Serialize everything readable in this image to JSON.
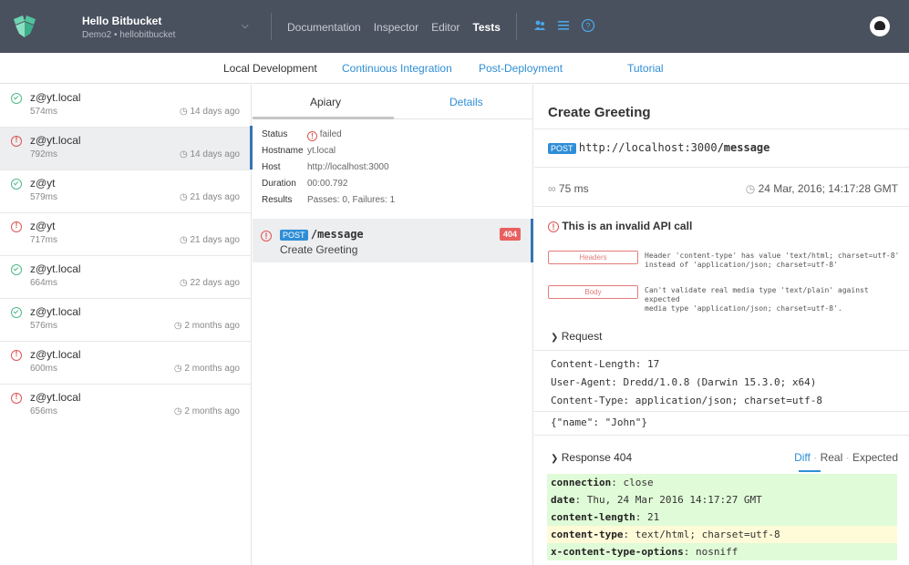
{
  "topbar": {
    "project_name": "Hello Bitbucket",
    "project_sub": "Demo2 • hellobitbucket",
    "nav": [
      "Documentation",
      "Inspector",
      "Editor",
      "Tests"
    ],
    "active_nav": "Tests"
  },
  "subnav": [
    "Local Development",
    "Continuous Integration",
    "Post-Deployment",
    "Tutorial"
  ],
  "runs": [
    {
      "status": "ok",
      "host": "z@yt.local",
      "ms": "574ms",
      "ago": "14 days ago"
    },
    {
      "status": "fail",
      "host": "z@yt.local",
      "ms": "792ms",
      "ago": "14 days ago"
    },
    {
      "status": "ok",
      "host": "z@yt",
      "ms": "579ms",
      "ago": "21 days ago"
    },
    {
      "status": "fail",
      "host": "z@yt",
      "ms": "717ms",
      "ago": "21 days ago"
    },
    {
      "status": "ok",
      "host": "z@yt.local",
      "ms": "664ms",
      "ago": "22 days ago"
    },
    {
      "status": "ok",
      "host": "z@yt.local",
      "ms": "576ms",
      "ago": "2 months ago"
    },
    {
      "status": "fail",
      "host": "z@yt.local",
      "ms": "600ms",
      "ago": "2 months ago"
    },
    {
      "status": "fail",
      "host": "z@yt.local",
      "ms": "656ms",
      "ago": "2 months ago"
    }
  ],
  "middle": {
    "tab_apiary": "Apiary",
    "tab_details": "Details",
    "props": {
      "status_label": "Status",
      "status_value": "failed",
      "hostname_label": "Hostname",
      "hostname_value": "yt.local",
      "host_label": "Host",
      "host_value": "http://localhost:3000",
      "duration_label": "Duration",
      "duration_value": "00:00.792",
      "results_label": "Results",
      "results_value": "Passes: 0, Failures: 1"
    },
    "endpoint": {
      "method": "POST",
      "path": "/message",
      "name": "Create Greeting",
      "code": "404"
    }
  },
  "right": {
    "title": "Create Greeting",
    "method": "POST",
    "url_base": "http://localhost:3000",
    "url_path": "/message",
    "duration": "75 ms",
    "timestamp": "24 Mar, 2016; 14:17:28 GMT",
    "invalid": "This is an invalid API call",
    "errors": [
      {
        "label": "Headers",
        "line1": "Header 'content-type' has value 'text/html; charset=utf-8'",
        "line2": "instead of 'application/json; charset=utf-8'"
      },
      {
        "label": "Body",
        "line1": "Can't validate real media type 'text/plain' against expected",
        "line2": "media type 'application/json; charset=utf-8'."
      }
    ],
    "request_label": "Request",
    "request_headers": [
      "Content-Length: 17",
      "User-Agent: Dredd/1.0.8 (Darwin 15.3.0; x64)",
      "Content-Type: application/json; charset=utf-8"
    ],
    "request_body": "{\"name\": \"John\"}",
    "response_label": "Response 404",
    "diff_tabs": {
      "diff": "Diff",
      "real": "Real",
      "expected": "Expected"
    },
    "response_headers": [
      {
        "key": "connection",
        "value": "close"
      },
      {
        "key": "date",
        "value": "Thu, 24 Mar 2016 14:17:27 GMT"
      },
      {
        "key": "content-length",
        "value": "21"
      },
      {
        "key": "content-type",
        "value": "text/html; charset=utf-8"
      },
      {
        "key": "x-content-type-options",
        "value": "nosniff"
      }
    ]
  },
  "colors": {
    "topbar": "#4a515e",
    "accent": "#2f8ed6",
    "fail": "#e05454",
    "ok": "#4fb98a",
    "diff_green": "#e0fbd7",
    "diff_yellow": "#fffbd9"
  }
}
